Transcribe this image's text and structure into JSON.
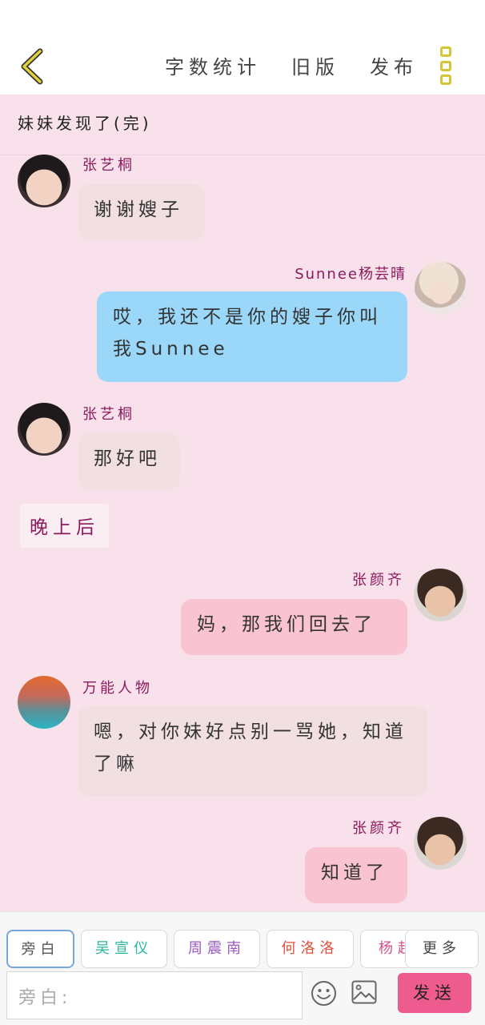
{
  "header": {
    "actions": [
      "字数统计",
      "旧版",
      "发布"
    ]
  },
  "chapter": {
    "title": "妹妹发现了(完)"
  },
  "messages": [
    {
      "sender": "张艺桐",
      "text": "谢谢嫂子"
    },
    {
      "sender": "Sunnee杨芸晴",
      "text": "哎，我还不是你的嫂子你叫我Sunnee"
    },
    {
      "sender": "张艺桐",
      "text": "那好吧"
    },
    {
      "narration": "晚上后"
    },
    {
      "sender": "张颜齐",
      "text": "妈，那我们回去了"
    },
    {
      "sender": "万能人物",
      "text": "嗯，对你妹好点别一骂她，知道了嘛"
    },
    {
      "sender": "张颜齐",
      "text": "知道了"
    }
  ],
  "roles": [
    {
      "label": "旁白",
      "color": "#555555"
    },
    {
      "label": "吴宣仪",
      "color": "#2bb79a"
    },
    {
      "label": "周震南",
      "color": "#9b59c6"
    },
    {
      "label": "何洛洛",
      "color": "#e0503a"
    },
    {
      "label": "杨超",
      "color": "#d2548a"
    },
    {
      "label": "更多",
      "color": "#444444"
    }
  ],
  "composer": {
    "placeholder": "旁白:",
    "send_label": "发送"
  },
  "icons": [
    "back-arrow-icon",
    "more-menu-icon",
    "emoji-icon",
    "image-icon"
  ],
  "colors": {
    "accent": "#ee5b8f",
    "background": "#f8e1ea",
    "name": "#8b1a5e",
    "menu_icon": "#d6c636"
  }
}
